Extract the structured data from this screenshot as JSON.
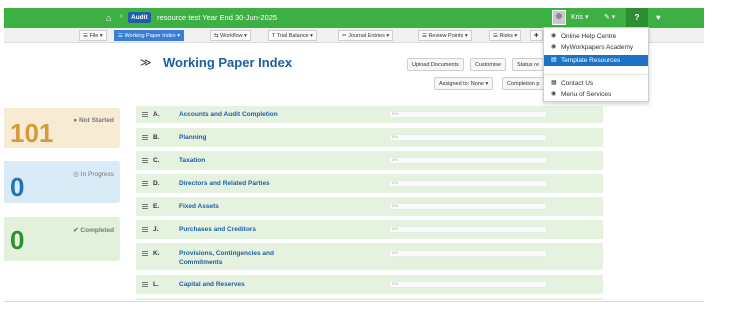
{
  "topbar": {
    "home_icon": "home-icon",
    "badge": "Audit",
    "crumb": "resource test  Year End 30-Jun-2025",
    "user": "Kris ▾",
    "tools_icon": "wrench-icon",
    "help_icon": "question-icon",
    "heart_icon": "heart-icon"
  },
  "toolbar": {
    "items": [
      "☰ File  ▾",
      "☰ Working Paper Index  ▾",
      "⇆ Workflow  ▾",
      "T  Trial Balance  ▾",
      "✂ Journal Entries  ▾",
      "☰ Review Points  ▾",
      "☰ Risks  ▾",
      "✚"
    ]
  },
  "stats": {
    "not_started": {
      "value": "101",
      "label": "● Not Started"
    },
    "in_progress": {
      "value": "0",
      "label": "◎ In Progress"
    },
    "completed": {
      "value": "0",
      "label": "✔ Completed"
    }
  },
  "main": {
    "title": "Working Paper Index",
    "buttons": {
      "upload": "Upload Documents",
      "customise": "Customise",
      "status": "Status re",
      "assigned": "Assigned to: None  ▾",
      "completion": "Completion p"
    }
  },
  "rows": [
    {
      "code": "A.",
      "title": "Accounts and Audit Completion"
    },
    {
      "code": "B.",
      "title": "Planning"
    },
    {
      "code": "C.",
      "title": "Taxation"
    },
    {
      "code": "D.",
      "title": "Directors and Related Parties"
    },
    {
      "code": "E.",
      "title": "Fixed Assets"
    },
    {
      "code": "J.",
      "title": "Purchases and Creditors"
    },
    {
      "code": "K.",
      "title": "Provisions, Contingencies and Commitments"
    },
    {
      "code": "L.",
      "title": "Capital and Reserves"
    }
  ],
  "row_percent": "0%",
  "help_menu": {
    "items": [
      {
        "icon": "globe-icon",
        "label": "Online Help Centre"
      },
      {
        "icon": "academy-icon",
        "label": "MyWorkpapers Academy"
      },
      {
        "icon": "file-icon",
        "label": "Template Resources",
        "highlighted": true
      },
      {
        "icon": "contact-icon",
        "label": "Contact Us"
      },
      {
        "icon": "services-icon",
        "label": "Menu of Services"
      }
    ]
  },
  "colors": {
    "brand_green": "#3db043",
    "accent_blue": "#1e5fa0",
    "highlight_blue": "#1a73c4"
  }
}
